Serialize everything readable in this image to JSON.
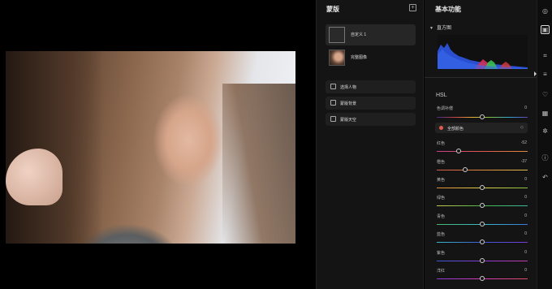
{
  "mask_panel": {
    "title": "蒙版",
    "add_icon": "plus-square-icon",
    "cards": [
      {
        "label": "自定义 1",
        "active": true
      },
      {
        "label": "完整图像",
        "active": false
      }
    ],
    "buttons": [
      {
        "label": "选择人物",
        "icon": "person-icon"
      },
      {
        "label": "蒙版背景",
        "icon": "image-icon"
      },
      {
        "label": "蒙版天空",
        "icon": "cloud-icon"
      }
    ]
  },
  "adjustments": {
    "title": "基本功能",
    "histogram_label": "直方图",
    "hsl_title": "HSL",
    "rows": [
      {
        "label": "色调补偿",
        "value": "0",
        "level": 0.0,
        "gradient": "linear-gradient(90deg,#3b2e8a,#c44,#e8b23a,#7bc043,#2ea8d8,#6a3fb5)"
      },
      {
        "label": "红色",
        "value": "-52",
        "level": -0.52,
        "gradient": "linear-gradient(90deg,#c8408f,#e05a4e,#e08a3a)"
      },
      {
        "label": "橙色",
        "value": "-37",
        "level": -0.37,
        "gradient": "linear-gradient(90deg,#d65a4a,#e08a3a,#e0c04a)"
      },
      {
        "label": "黄色",
        "value": "0",
        "level": 0.0,
        "gradient": "linear-gradient(90deg,#e08a3a,#e0d24a,#8ac040)"
      },
      {
        "label": "绿色",
        "value": "0",
        "level": 0.0,
        "gradient": "linear-gradient(90deg,#c8c84a,#4ab84a,#3ab8a0)"
      },
      {
        "label": "青色",
        "value": "0",
        "level": 0.0,
        "gradient": "linear-gradient(90deg,#4ab86a,#3ab8c8,#3a7ad8)"
      },
      {
        "label": "蓝色",
        "value": "0",
        "level": 0.0,
        "gradient": "linear-gradient(90deg,#3ab8c8,#3a5ad8,#7a3ad8)"
      },
      {
        "label": "紫色",
        "value": "0",
        "level": 0.0,
        "gradient": "linear-gradient(90deg,#3a5ad8,#8a3ad8,#c83aa8)"
      },
      {
        "label": "洋红",
        "value": "0",
        "level": 0.0,
        "gradient": "linear-gradient(90deg,#8a3ad8,#d83ab8,#e04a6a)"
      }
    ],
    "color_select": {
      "label": "全部颜色",
      "swatch": "#e05a4e"
    }
  },
  "tools": [
    {
      "icon": "presets-icon",
      "glyph": "◎",
      "active": false
    },
    {
      "icon": "basic-adjust-icon",
      "glyph": "▣",
      "active": true
    },
    {
      "icon": "crop-icon",
      "glyph": "⌗",
      "active": false
    },
    {
      "icon": "sliders-icon",
      "glyph": "≡",
      "active": false
    },
    {
      "icon": "mask-icon",
      "glyph": "♡",
      "active": false
    },
    {
      "icon": "grid-icon",
      "glyph": "▦",
      "active": false
    },
    {
      "icon": "effects-icon",
      "glyph": "✲",
      "active": false
    },
    {
      "icon": "info-icon",
      "glyph": "ⓘ",
      "active": false
    },
    {
      "icon": "undo-icon",
      "glyph": "↶",
      "active": false
    }
  ]
}
